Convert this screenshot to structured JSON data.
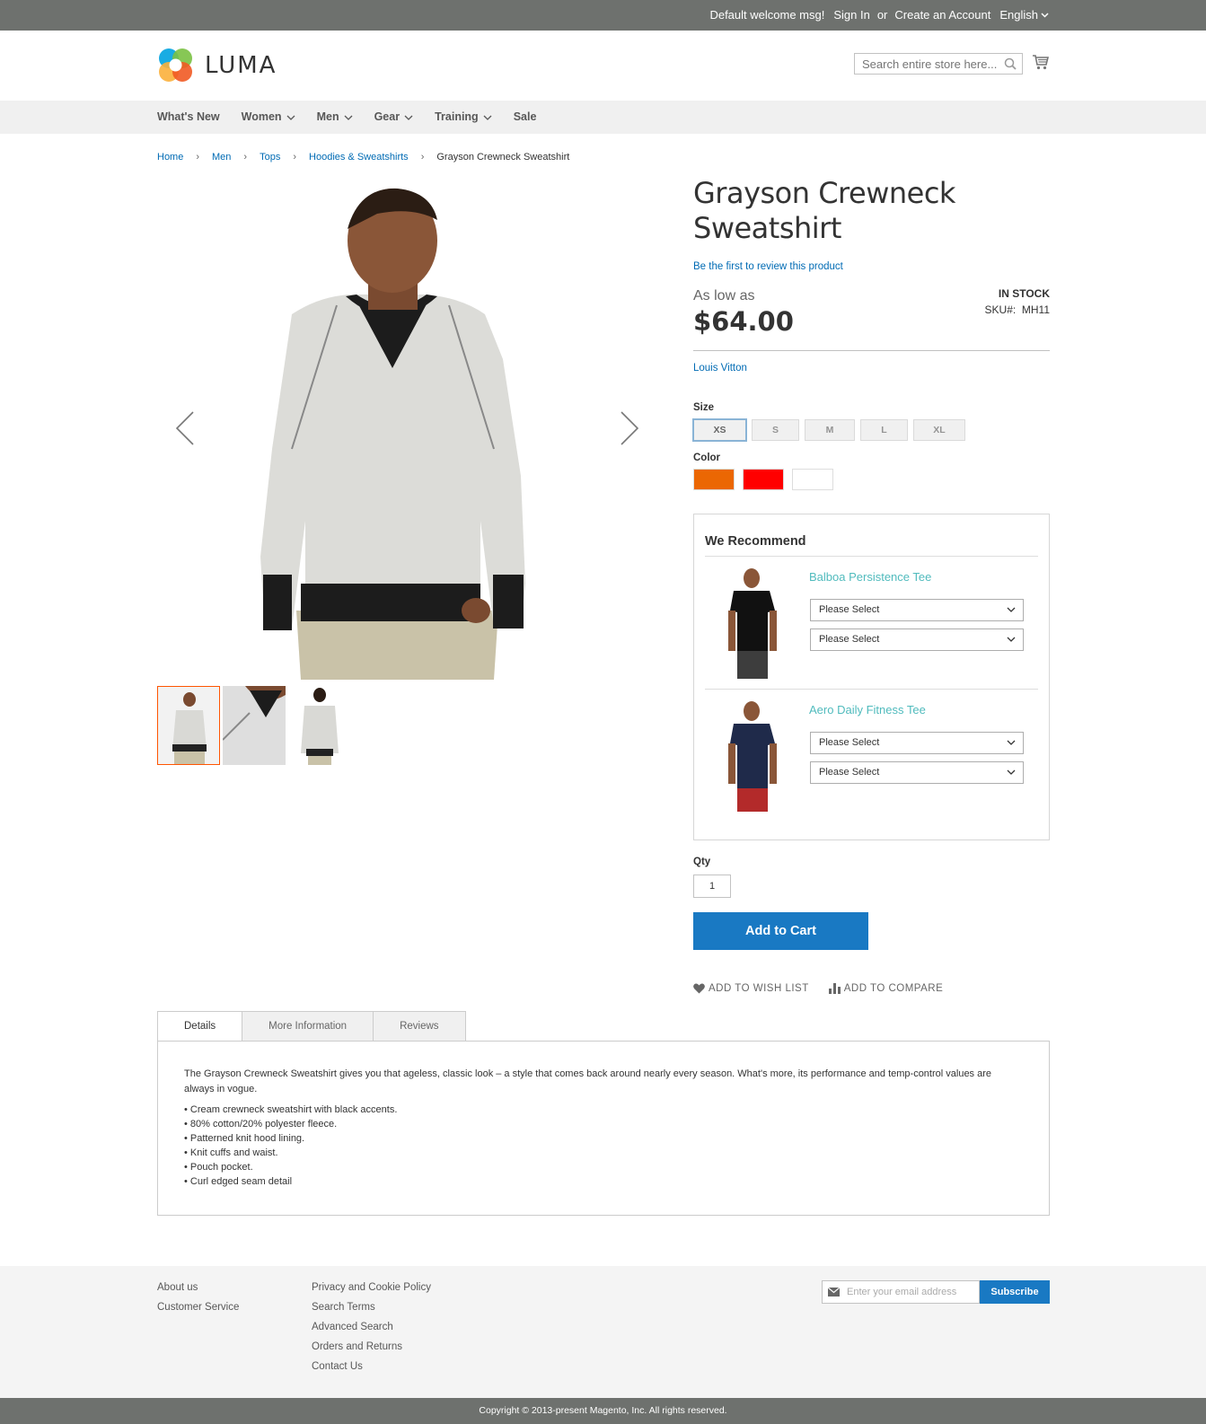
{
  "top_panel": {
    "welcome": "Default welcome msg!",
    "sign_in": "Sign In",
    "or": "or",
    "create_account": "Create an Account",
    "language": "English"
  },
  "header": {
    "logo_text": "LUMA",
    "search_placeholder": "Search entire store here..."
  },
  "nav": {
    "items": [
      {
        "label": "What's New",
        "has_dropdown": false
      },
      {
        "label": "Women",
        "has_dropdown": true
      },
      {
        "label": "Men",
        "has_dropdown": true
      },
      {
        "label": "Gear",
        "has_dropdown": true
      },
      {
        "label": "Training",
        "has_dropdown": true
      },
      {
        "label": "Sale",
        "has_dropdown": false
      }
    ]
  },
  "breadcrumb": [
    "Home",
    "Men",
    "Tops",
    "Hoodies & Sweatshirts",
    "Grayson Crewneck Sweatshirt"
  ],
  "product": {
    "title_line1": "Grayson Crewneck",
    "title_line2": "Sweatshirt",
    "review_link": "Be the first to review this product",
    "price_prefix": "As low as",
    "price": "$64.00",
    "stock": "In stock",
    "sku_label": "SKU#:",
    "sku": "MH11",
    "brand": "Louis Vitton",
    "size_label": "Size",
    "sizes": [
      "XS",
      "S",
      "M",
      "L",
      "XL"
    ],
    "selected_size": "XS",
    "color_label": "Color",
    "colors": [
      "#eb6703",
      "#ff0000",
      "#ffffff"
    ],
    "qty_label": "Qty",
    "qty": "1",
    "add_to_cart": "Add to Cart",
    "wishlist": "Add to Wish List",
    "compare": "Add to Compare"
  },
  "recommend": {
    "title": "We Recommend",
    "items": [
      {
        "name": "Balboa Persistence Tee",
        "select1": "Please Select",
        "select2": "Please Select"
      },
      {
        "name": "Aero Daily Fitness Tee",
        "select1": "Please Select",
        "select2": "Please Select"
      }
    ]
  },
  "tabs": {
    "details": "Details",
    "more_info": "More Information",
    "reviews": "Reviews"
  },
  "details": {
    "description": "The Grayson Crewneck Sweatshirt gives you that ageless, classic look – a style that comes back around nearly every season. What's more, its performance and temp-control values are always in vogue.",
    "bullets": [
      "• Cream crewneck sweatshirt with black accents.",
      "• 80% cotton/20% polyester fleece.",
      "• Patterned knit hood lining.",
      "• Knit cuffs and waist.",
      "• Pouch pocket.",
      "• Curl edged seam detail"
    ]
  },
  "footer": {
    "col1": [
      "About us",
      "Customer Service"
    ],
    "col2": [
      "Privacy and Cookie Policy",
      "Search Terms",
      "Advanced Search",
      "Orders and Returns",
      "Contact Us"
    ],
    "newsletter_placeholder": "Enter your email address",
    "subscribe": "Subscribe",
    "copyright": "Copyright © 2013-present Magento, Inc. All rights reserved."
  }
}
